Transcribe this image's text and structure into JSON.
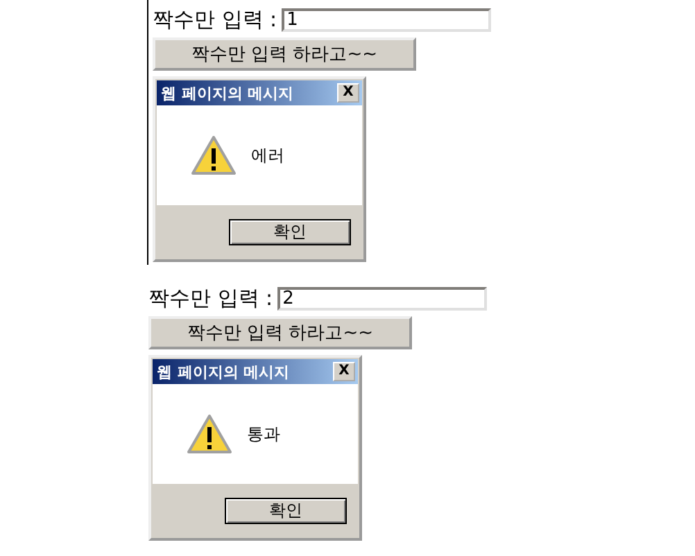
{
  "examples": [
    {
      "framed": true,
      "label": "짝수만 입력 :",
      "input_value": "1",
      "button": "짝수만 입력 하라고~~",
      "dialog": {
        "title": "웹 페이지의 메시지",
        "close": "X",
        "message": "에러",
        "ok": "확인"
      }
    },
    {
      "framed": false,
      "label": "짝수만 입력 :",
      "input_value": "2",
      "button": "짝수만 입력 하라고~~",
      "dialog": {
        "title": "웹 페이지의 메시지",
        "close": "X",
        "message": "통과",
        "ok": "확인"
      }
    }
  ]
}
